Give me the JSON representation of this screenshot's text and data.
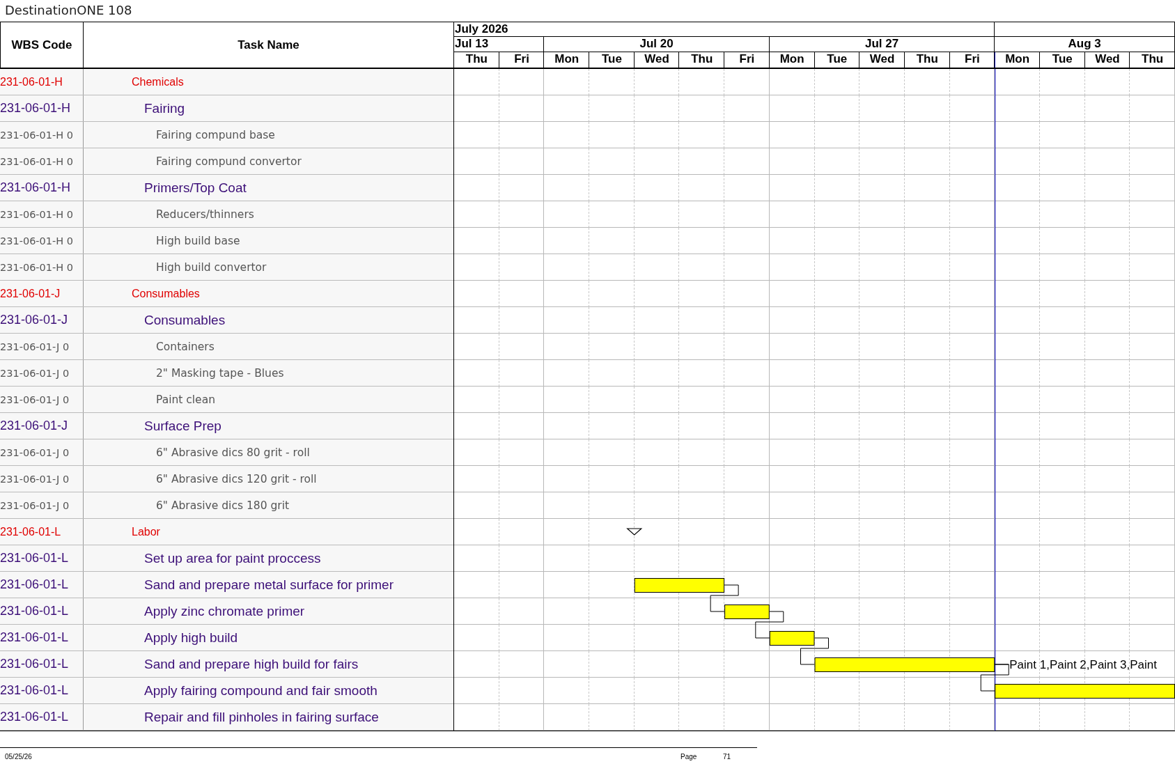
{
  "title": "DestinationONE 108",
  "columns": {
    "code": "WBS Code",
    "name": "Task Name"
  },
  "timeline": {
    "months": [
      {
        "label": "July 2026",
        "weeks": [
          {
            "label": "Jul 13",
            "days": [
              {
                "label": "Thu",
                "today": false
              },
              {
                "label": "Fri",
                "today": false
              }
            ]
          },
          {
            "label": "Jul 20",
            "days": [
              {
                "label": "Mon",
                "today": false
              },
              {
                "label": "Tue",
                "today": false
              },
              {
                "label": "Wed",
                "today": false
              },
              {
                "label": "Thu",
                "today": false
              },
              {
                "label": "Fri",
                "today": false
              }
            ]
          },
          {
            "label": "Jul 27",
            "days": [
              {
                "label": "Mon",
                "today": false
              },
              {
                "label": "Tue",
                "today": false
              },
              {
                "label": "Wed",
                "today": false
              },
              {
                "label": "Thu",
                "today": false
              },
              {
                "label": "Fri",
                "today": false
              }
            ]
          }
        ]
      },
      {
        "weeks": [
          {
            "label": "Aug 3",
            "days": [
              {
                "label": "Mon",
                "today": true
              },
              {
                "label": "Tue",
                "today": false
              },
              {
                "label": "Wed",
                "today": false
              },
              {
                "label": "Thu",
                "today": false
              }
            ]
          }
        ]
      }
    ]
  },
  "rows": [
    {
      "code": "231-06-01-H",
      "name": "Chemicals",
      "children": [
        {
          "code": "231-06-01-H",
          "name": "Fairing",
          "children": [
            {
              "code": "231-06-01-H 0",
              "name": "Fairing compund base"
            },
            {
              "code": "231-06-01-H 0",
              "name": "Fairing compund convertor"
            }
          ]
        },
        {
          "code": "231-06-01-H",
          "name": "Primers/Top Coat",
          "children": [
            {
              "code": "231-06-01-H 0",
              "name": "Reducers/thinners"
            },
            {
              "code": "231-06-01-H 0",
              "name": "High build base"
            },
            {
              "code": "231-06-01-H 0",
              "name": "High build convertor"
            }
          ]
        }
      ]
    },
    {
      "code": "231-06-01-J",
      "name": "Consumables",
      "children": [
        {
          "code": "231-06-01-J",
          "name": "Consumables",
          "children": [
            {
              "code": "231-06-01-J 0",
              "name": "Containers"
            },
            {
              "code": "231-06-01-J 0",
              "name": "2\" Masking tape - Blues"
            },
            {
              "code": "231-06-01-J 0",
              "name": "Paint clean"
            }
          ]
        },
        {
          "code": "231-06-01-J",
          "name": "Surface Prep",
          "children": [
            {
              "code": "231-06-01-J 0",
              "name": "6\" Abrasive dics 80 grit - roll"
            },
            {
              "code": "231-06-01-J 0",
              "name": "6\" Abrasive dics 120 grit - roll"
            },
            {
              "code": "231-06-01-J 0",
              "name": "6\" Abrasive dics 180 grit"
            }
          ]
        }
      ]
    },
    {
      "code": "231-06-01-L",
      "name": "Labor",
      "marker": [
        false,
        false,
        false,
        false,
        true,
        false,
        false,
        false,
        false,
        false,
        false,
        false,
        false,
        false,
        false,
        false
      ],
      "children": [
        {
          "code": "231-06-01-L",
          "name": "Set up area for paint proccess"
        },
        {
          "code": "231-06-01-L",
          "name": "Sand and prepare metal surface for primer",
          "bar": [
            false,
            false,
            false,
            false,
            true,
            true,
            false,
            false,
            false,
            false,
            false,
            false,
            false,
            false,
            false,
            false
          ]
        },
        {
          "code": "231-06-01-L",
          "name": "Apply zinc chromate primer",
          "bar": [
            false,
            false,
            false,
            false,
            false,
            false,
            true,
            false,
            false,
            false,
            false,
            false,
            false,
            false,
            false,
            false
          ]
        },
        {
          "code": "231-06-01-L",
          "name": "Apply high build",
          "bar": [
            false,
            false,
            false,
            false,
            false,
            false,
            false,
            true,
            false,
            false,
            false,
            false,
            false,
            false,
            false,
            false
          ]
        },
        {
          "code": "231-06-01-L",
          "name": "Sand and prepare high build for fairs",
          "bar": [
            false,
            false,
            false,
            false,
            false,
            false,
            false,
            false,
            true,
            true,
            true,
            true,
            false,
            false,
            false,
            false
          ],
          "resources": "Paint 1,Paint 2,Paint 3,Paint"
        },
        {
          "code": "231-06-01-L",
          "name": "Apply fairing compound and fair smooth",
          "bar": [
            false,
            false,
            false,
            false,
            false,
            false,
            false,
            false,
            false,
            false,
            false,
            false,
            true,
            true,
            true,
            true
          ]
        },
        {
          "code": "231-06-01-L",
          "name": "Repair and fill pinholes in fairing surface"
        }
      ]
    }
  ],
  "footer": {
    "date": "05/25/26",
    "page_label": "Page",
    "page_number": "71"
  }
}
